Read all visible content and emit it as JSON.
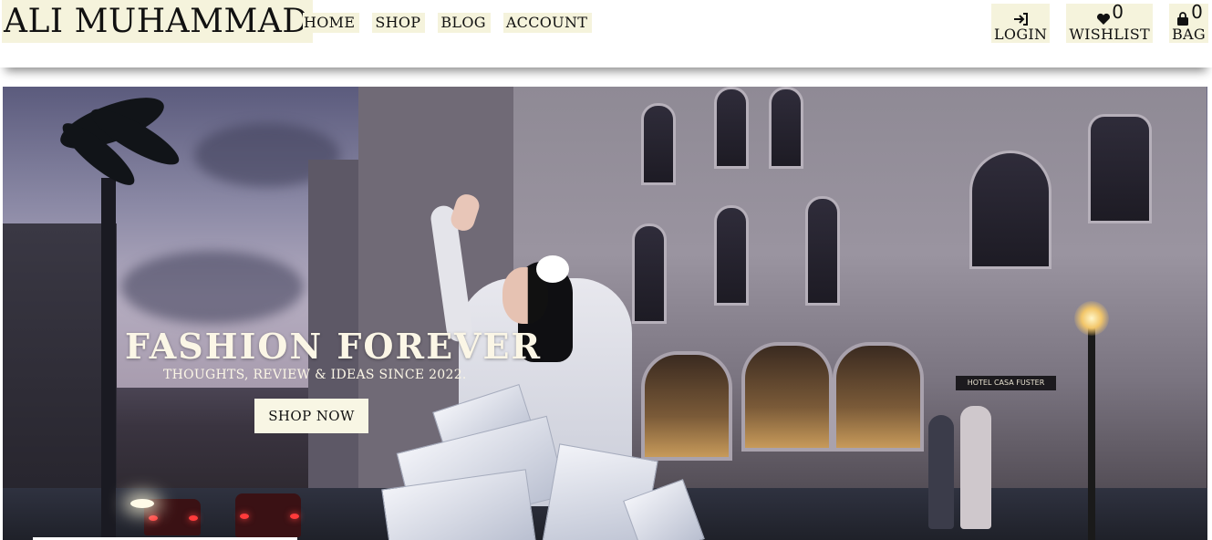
{
  "brand": {
    "name": "ALI MUHAMMAD"
  },
  "nav": {
    "items": [
      {
        "label": "HOME"
      },
      {
        "label": "SHOP"
      },
      {
        "label": "BLOG"
      },
      {
        "label": "ACCOUNT"
      }
    ]
  },
  "actions": {
    "login": {
      "label": "LOGIN",
      "icon": "login-icon"
    },
    "wishlist": {
      "label": "WISHLIST",
      "count": "0",
      "icon": "heart-icon"
    },
    "bag": {
      "label": "BAG",
      "count": "0",
      "icon": "bag-icon"
    }
  },
  "hero": {
    "title": "FASHION FOREVER",
    "subtitle": "THOUGHTS, REVIEW & IDEAS SINCE 2022.",
    "cta_label": "SHOP NOW",
    "image_description": "woman in white with shopping bags hailing on a city street at dusk",
    "sign_text": "HOTEL CASA FUSTER"
  },
  "colors": {
    "accent_bg": "#f5f3dc",
    "hero_text": "#fbf6e6",
    "button_bg": "#f8f6e4"
  }
}
